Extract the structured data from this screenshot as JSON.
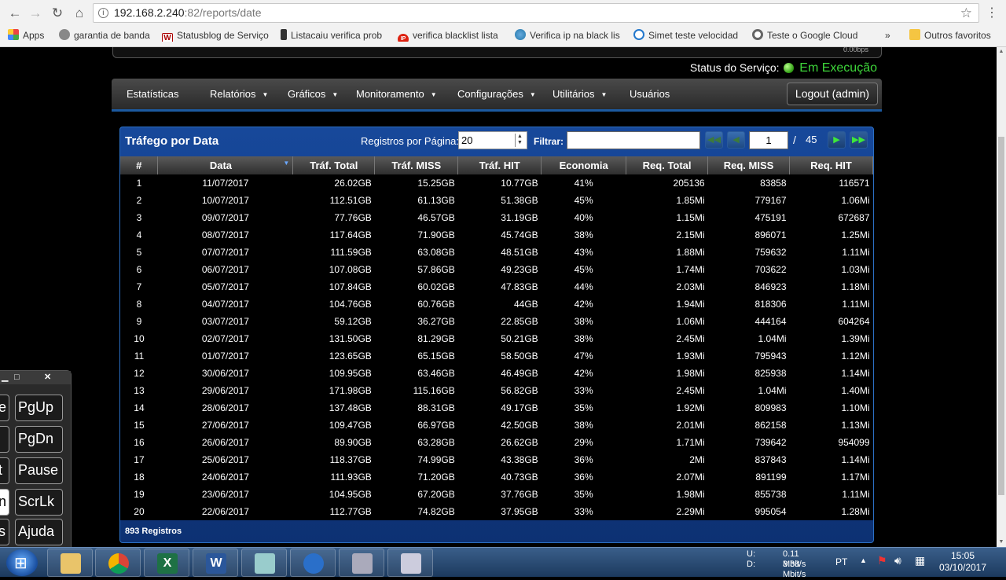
{
  "browser": {
    "url_host": "192.168.2.240",
    "url_path": ":82/reports/date",
    "bookmarks": [
      "Apps",
      "garantia de banda",
      "Statusblog de Serviço",
      "Listacaiu verifica prob",
      "verifica blacklist lista",
      "Verifica ip na black lis",
      "Simet teste velocidad",
      "Teste o Google Cloud",
      "»",
      "Outros favoritos"
    ]
  },
  "header": {
    "top_speed": "0.00bps",
    "status_label": "Status do Serviço:",
    "status_value": "Em Execução"
  },
  "nav": {
    "items": [
      "Estatísticas",
      "Relatórios",
      "Gráficos",
      "Monitoramento",
      "Configurações",
      "Utilitários",
      "Usuários"
    ],
    "logout": "Logout (admin)"
  },
  "panel": {
    "title": "Tráfego por Data",
    "rpp_label": "Registros por Página:",
    "rpp_value": "20",
    "filter_label": "Filtrar:",
    "current_page": "1",
    "page_sep": "/",
    "total_pages": "45",
    "footer": "893 Registros"
  },
  "table": {
    "columns": [
      "#",
      "Data",
      "Tráf. Total",
      "Tráf. MISS",
      "Tráf. HIT",
      "Economia",
      "Req. Total",
      "Req. MISS",
      "Req. HIT"
    ],
    "rows": [
      [
        "1",
        "11/07/2017",
        "26.02GB",
        "15.25GB",
        "10.77GB",
        "41%",
        "205136",
        "83858",
        "116571"
      ],
      [
        "2",
        "10/07/2017",
        "112.51GB",
        "61.13GB",
        "51.38GB",
        "45%",
        "1.85Mi",
        "779167",
        "1.06Mi"
      ],
      [
        "3",
        "09/07/2017",
        "77.76GB",
        "46.57GB",
        "31.19GB",
        "40%",
        "1.15Mi",
        "475191",
        "672687"
      ],
      [
        "4",
        "08/07/2017",
        "117.64GB",
        "71.90GB",
        "45.74GB",
        "38%",
        "2.15Mi",
        "896071",
        "1.25Mi"
      ],
      [
        "5",
        "07/07/2017",
        "111.59GB",
        "63.08GB",
        "48.51GB",
        "43%",
        "1.88Mi",
        "759632",
        "1.11Mi"
      ],
      [
        "6",
        "06/07/2017",
        "107.08GB",
        "57.86GB",
        "49.23GB",
        "45%",
        "1.74Mi",
        "703622",
        "1.03Mi"
      ],
      [
        "7",
        "05/07/2017",
        "107.84GB",
        "60.02GB",
        "47.83GB",
        "44%",
        "2.03Mi",
        "846923",
        "1.18Mi"
      ],
      [
        "8",
        "04/07/2017",
        "104.76GB",
        "60.76GB",
        "44GB",
        "42%",
        "1.94Mi",
        "818306",
        "1.11Mi"
      ],
      [
        "9",
        "03/07/2017",
        "59.12GB",
        "36.27GB",
        "22.85GB",
        "38%",
        "1.06Mi",
        "444164",
        "604264"
      ],
      [
        "10",
        "02/07/2017",
        "131.50GB",
        "81.29GB",
        "50.21GB",
        "38%",
        "2.45Mi",
        "1.04Mi",
        "1.39Mi"
      ],
      [
        "11",
        "01/07/2017",
        "123.65GB",
        "65.15GB",
        "58.50GB",
        "47%",
        "1.93Mi",
        "795943",
        "1.12Mi"
      ],
      [
        "12",
        "30/06/2017",
        "109.95GB",
        "63.46GB",
        "46.49GB",
        "42%",
        "1.98Mi",
        "825938",
        "1.14Mi"
      ],
      [
        "13",
        "29/06/2017",
        "171.98GB",
        "115.16GB",
        "56.82GB",
        "33%",
        "2.45Mi",
        "1.04Mi",
        "1.40Mi"
      ],
      [
        "14",
        "28/06/2017",
        "137.48GB",
        "88.31GB",
        "49.17GB",
        "35%",
        "1.92Mi",
        "809983",
        "1.10Mi"
      ],
      [
        "15",
        "27/06/2017",
        "109.47GB",
        "66.97GB",
        "42.50GB",
        "38%",
        "2.01Mi",
        "862158",
        "1.13Mi"
      ],
      [
        "16",
        "26/06/2017",
        "89.90GB",
        "63.28GB",
        "26.62GB",
        "29%",
        "1.71Mi",
        "739642",
        "954099"
      ],
      [
        "17",
        "25/06/2017",
        "118.37GB",
        "74.99GB",
        "43.38GB",
        "36%",
        "2Mi",
        "837843",
        "1.14Mi"
      ],
      [
        "18",
        "24/06/2017",
        "111.93GB",
        "71.20GB",
        "40.73GB",
        "36%",
        "2.07Mi",
        "891199",
        "1.17Mi"
      ],
      [
        "19",
        "23/06/2017",
        "104.95GB",
        "67.20GB",
        "37.76GB",
        "35%",
        "1.98Mi",
        "855738",
        "1.11Mi"
      ],
      [
        "20",
        "22/06/2017",
        "112.77GB",
        "74.82GB",
        "37.95GB",
        "33%",
        "2.29Mi",
        "995054",
        "1.28Mi"
      ]
    ]
  },
  "osk": {
    "keys": [
      "e",
      "PgUp",
      "",
      "PgDn",
      "t",
      "Pause",
      "n",
      "ScrLk",
      "s",
      "Ajuda"
    ]
  },
  "taskbar": {
    "net_up_label": "U:",
    "net_down_label": "D:",
    "net_up": "0.11 Mbit/s",
    "net_down": "3.38 Mbit/s",
    "lang": "PT",
    "time": "15:05",
    "date": "03/10/2017"
  },
  "colors": {
    "accent": "#1c5aa0",
    "status_green": "#3ed63a"
  }
}
